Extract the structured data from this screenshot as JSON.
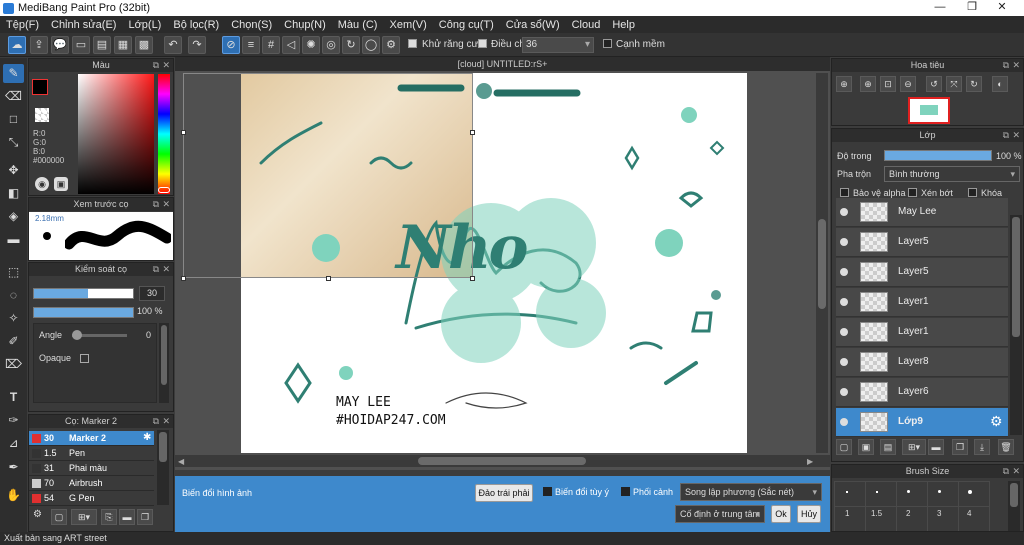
{
  "window": {
    "title": "MediBang Paint Pro (32bit)"
  },
  "menu": [
    "Tệp(F)",
    "Chỉnh sửa(E)",
    "Lớp(L)",
    "Bộ lọc(R)",
    "Chọn(S)",
    "Chụp(N)",
    "Màu (C)",
    "Xem(V)",
    "Công cụ(T)",
    "Cửa sổ(W)",
    "Cloud",
    "Help"
  ],
  "toolbar": {
    "antialias_label": "Khử răng cưa",
    "adjust_label": "Điều chỉnh",
    "adjust_value": "36",
    "smooth_label": "Cạnh mềm"
  },
  "color_panel": {
    "title": "Màu",
    "r": "R:0",
    "g": "G:0",
    "b": "B:0",
    "hex": "#000000"
  },
  "brush_preview": {
    "title": "Xem trước cọ",
    "size": "2.18mm"
  },
  "brush_control": {
    "title": "Kiểm soát cọ",
    "size_value": "30",
    "opacity_value": "100 %",
    "angle_label": "Angle",
    "angle_value": "0",
    "opaque_label": "Opaque"
  },
  "brush_list": {
    "title": "Cọ: Marker 2",
    "items": [
      {
        "size": "30",
        "name": "Marker 2",
        "color": "#e03030"
      },
      {
        "size": "1.5",
        "name": "Pen",
        "color": "#333333"
      },
      {
        "size": "31",
        "name": "Phai màu",
        "color": "#333333"
      },
      {
        "size": "70",
        "name": "Airbrush",
        "color": "#cccccc"
      },
      {
        "size": "54",
        "name": "G Pen",
        "color": "#e03030"
      }
    ]
  },
  "document": {
    "tab": "[cloud] UNTITLED:rS+",
    "signature_name": "MAY LEE",
    "signature_tag": "#HOIDAP247.COM",
    "lettering": "Nho"
  },
  "transform_bar": {
    "label": "Biến đổi hình ảnh",
    "flip_button": "Đảo trái phải",
    "free_transform": "Biến đổi tùy ý",
    "perspective": "Phối cảnh",
    "interpolation": "Song lập phương (Sắc nét)",
    "anchor": "Cố định ở trung tâm",
    "ok": "Ok",
    "cancel": "Hủy"
  },
  "navigator": {
    "title": "Hoa tiêu"
  },
  "layer_panel": {
    "title": "Lớp",
    "opacity_label": "Độ trong",
    "opacity_value": "100 %",
    "blend_label": "Pha trộn",
    "blend_value": "Bình thường",
    "protect_alpha": "Bảo vệ alpha",
    "clipping": "Xén bớt",
    "lock": "Khóa",
    "layers": [
      "May Lee",
      "Layer5",
      "Layer5",
      "Layer1",
      "Layer1",
      "Layer8",
      "Layer6",
      "Lớp9"
    ]
  },
  "brush_size_panel": {
    "title": "Brush Size",
    "sizes": [
      "1",
      "1.5",
      "2",
      "3",
      "4"
    ]
  },
  "status": "Xuất bản sang ART street",
  "colors": {
    "accent": "#3e89cc",
    "teal": "#2f7f73",
    "mint": "#7fd3bd"
  }
}
